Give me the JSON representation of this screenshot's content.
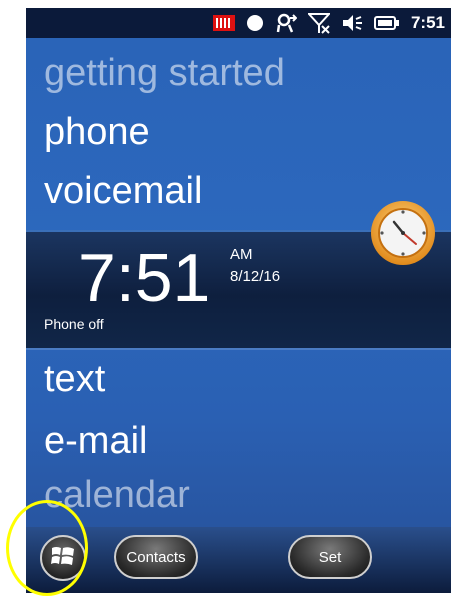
{
  "status": {
    "time": "7:51"
  },
  "menu": {
    "getting_started": "getting started",
    "phone": "phone",
    "voicemail": "voicemail",
    "text": "text",
    "email": "e-mail",
    "calendar": "calendar"
  },
  "clock": {
    "time": "7:51",
    "ampm": "AM",
    "date": "8/12/16",
    "phone_status": "Phone off"
  },
  "softkeys": {
    "contacts": "Contacts",
    "set": "Set"
  },
  "colors": {
    "highlight": "#ffff00",
    "background": "#2a63b7"
  }
}
